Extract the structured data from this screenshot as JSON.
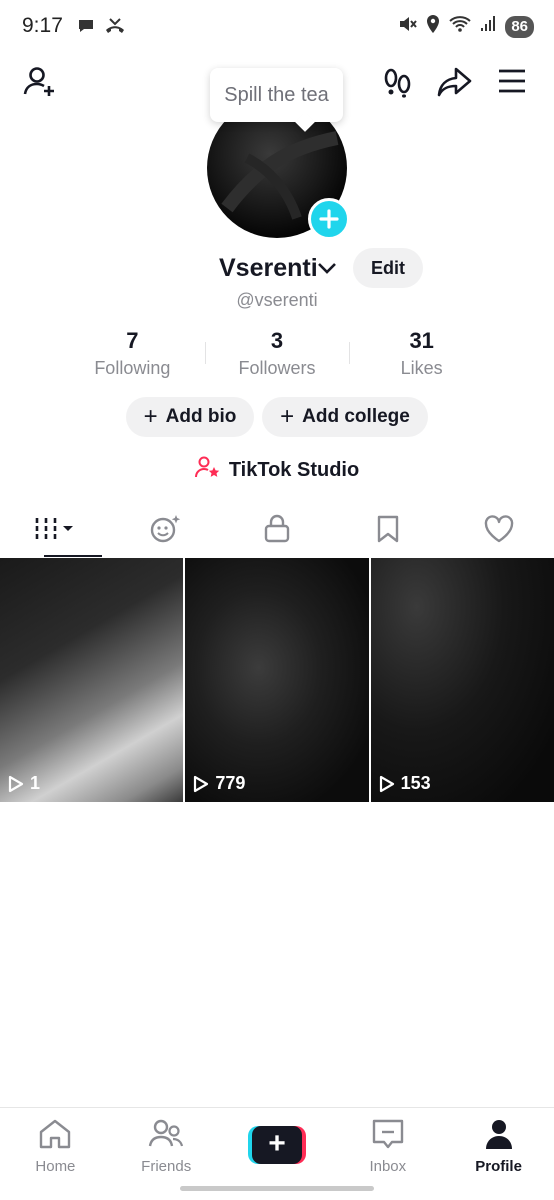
{
  "status_bar": {
    "time": "9:17",
    "left_icons": [
      "chat-icon",
      "missed-call-icon"
    ],
    "right_icons": [
      "mute-icon",
      "location-icon",
      "wifi-icon",
      "signal-icon"
    ],
    "battery": "86"
  },
  "top_nav": {
    "icons": [
      "add-friend-icon",
      "footprints-icon",
      "share-icon",
      "menu-icon"
    ],
    "tooltip": "Spill the tea"
  },
  "profile": {
    "display_name": "Vserenti",
    "edit_label": "Edit",
    "handle": "@vserenti"
  },
  "stats": [
    {
      "value": "7",
      "label": "Following"
    },
    {
      "value": "3",
      "label": "Followers"
    },
    {
      "value": "31",
      "label": "Likes"
    }
  ],
  "actions": {
    "add_bio": "Add bio",
    "add_college": "Add college",
    "studio": "TikTok Studio"
  },
  "tabs": [
    "videos-grid-icon",
    "reposts-icon",
    "private-lock-icon",
    "favorites-bookmark-icon",
    "liked-heart-icon"
  ],
  "videos": [
    {
      "views": "1"
    },
    {
      "views": "779"
    },
    {
      "views": "153"
    }
  ],
  "bottom_nav": [
    {
      "label": "Home",
      "icon": "home-icon"
    },
    {
      "label": "Friends",
      "icon": "friends-icon"
    },
    {
      "label": "",
      "icon": "create-plus-icon"
    },
    {
      "label": "Inbox",
      "icon": "inbox-icon"
    },
    {
      "label": "Profile",
      "icon": "profile-icon"
    }
  ],
  "colors": {
    "accent_cyan": "#20d5ec",
    "accent_red": "#fe2c55",
    "studio_pink": "#fe2c55",
    "text_primary": "#161823",
    "text_secondary": "#8a8b91"
  }
}
